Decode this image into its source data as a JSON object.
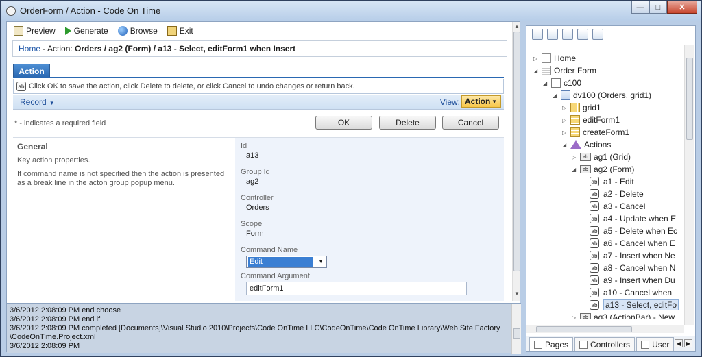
{
  "window": {
    "title": "OrderForm / Action - Code On Time"
  },
  "toolbar": {
    "preview": "Preview",
    "generate": "Generate",
    "browse": "Browse",
    "exit": "Exit"
  },
  "breadcrumb": {
    "home": "Home",
    "prefix": " - Action: ",
    "path": "Orders / ag2 (Form) / a13 - Select, editForm1 when Insert"
  },
  "tab": {
    "label": "Action"
  },
  "info": {
    "text": "Click OK to save the action, click Delete to delete, or click Cancel to undo changes or return back."
  },
  "record_bar": {
    "record": "Record",
    "view_label": "View:",
    "view_value": "Action"
  },
  "required_note": "* - indicates a required field",
  "buttons": {
    "ok": "OK",
    "delete": "Delete",
    "cancel": "Cancel"
  },
  "category": {
    "title": "General",
    "desc1": "Key action properties.",
    "desc2": "If command name is not specified then the action is presented as a break line in the acton group popup menu."
  },
  "fields": {
    "id": {
      "label": "Id",
      "value": "a13"
    },
    "group_id": {
      "label": "Group Id",
      "value": "ag2"
    },
    "controller": {
      "label": "Controller",
      "value": "Orders"
    },
    "scope": {
      "label": "Scope",
      "value": "Form"
    },
    "command_name": {
      "label": "Command Name",
      "value": "Edit"
    },
    "command_argument": {
      "label": "Command Argument",
      "value": "editForm1"
    }
  },
  "log": {
    "lines": [
      "3/6/2012 2:08:09 PM end choose",
      "3/6/2012 2:08:09 PM end if",
      "3/6/2012 2:08:09 PM completed [Documents]\\Visual Studio 2010\\Projects\\Code OnTime LLC\\CodeOnTime\\Code OnTime Library\\Web Site Factory",
      "\\CodeOnTime.Project.xml",
      "3/6/2012 2:08:09 PM"
    ]
  },
  "tree": {
    "home": "Home",
    "order_form": "Order Form",
    "c100": "c100",
    "dv100": "dv100 (Orders, grid1)",
    "grid1": "grid1",
    "editForm1": "editForm1",
    "createForm1": "createForm1",
    "actions": "Actions",
    "ag1": "ag1 (Grid)",
    "ag2": "ag2 (Form)",
    "a1": "a1 - Edit",
    "a2": "a2 - Delete",
    "a3": "a3 - Cancel",
    "a4": "a4 - Update when E",
    "a5": "a5 - Delete when Ec",
    "a6": "a6 - Cancel when E",
    "a7": "a7 - Insert when Ne",
    "a8": "a8 - Cancel when N",
    "a9": "a9 - Insert when Du",
    "a10": "a10 - Cancel when",
    "a13": "a13 - Select, editFo",
    "ag3": "ag3 (ActionBar) - New"
  },
  "bottom_tabs": {
    "pages": "Pages",
    "controllers": "Controllers",
    "user": "User"
  }
}
